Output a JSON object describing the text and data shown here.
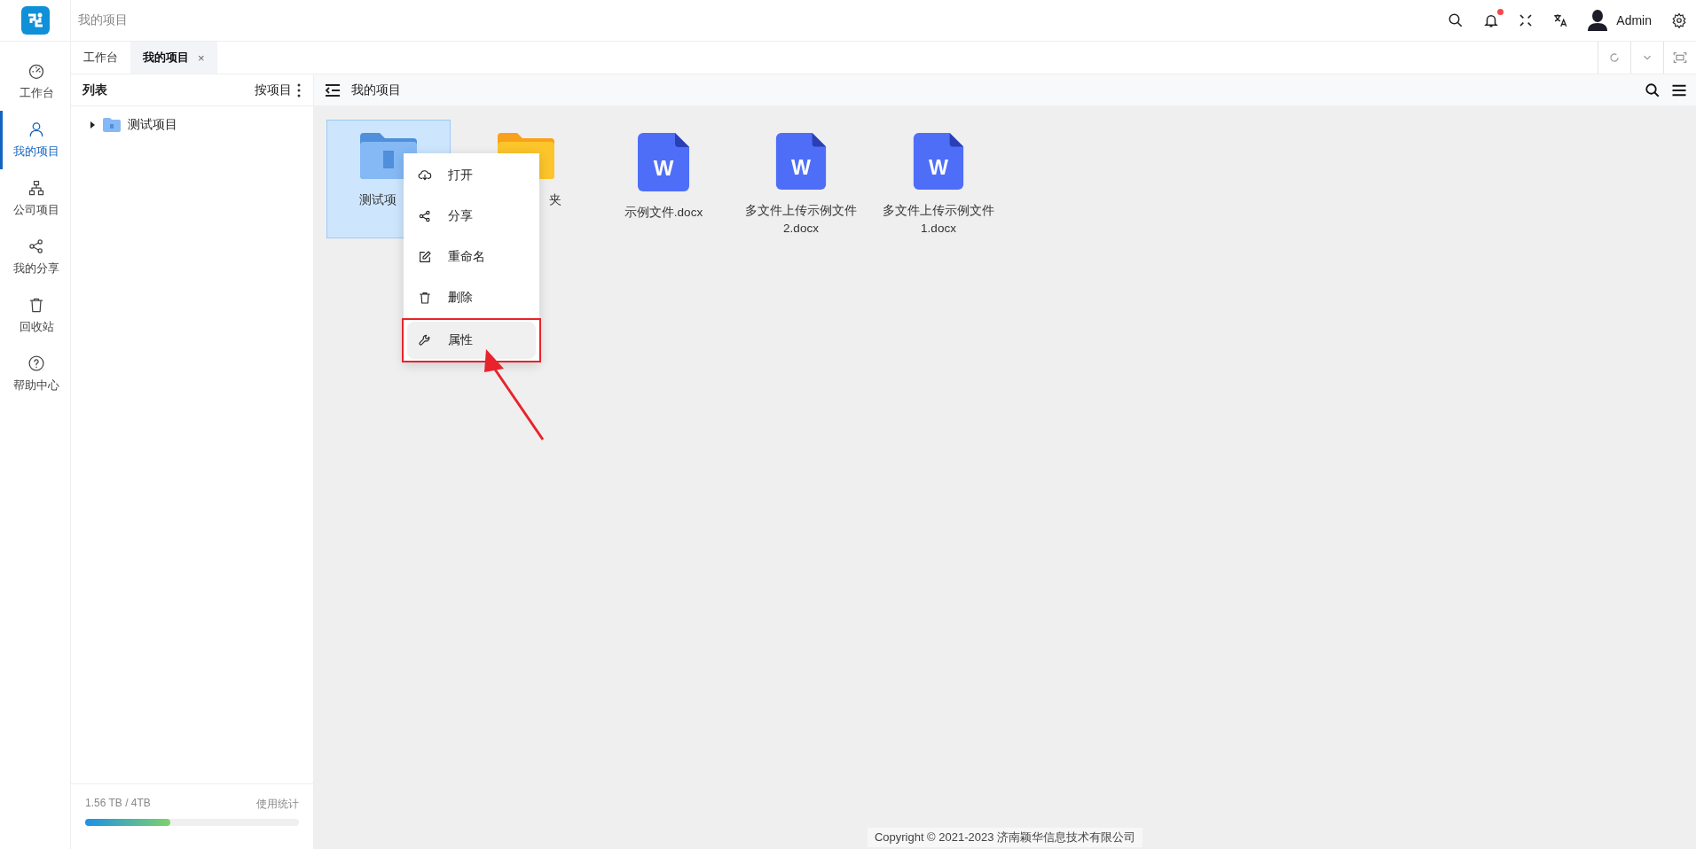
{
  "header": {
    "breadcrumb": "我的项目",
    "user": "Admin",
    "notification_dot": true
  },
  "nav": [
    {
      "label": "工作台",
      "selected": false
    },
    {
      "label": "我的项目",
      "selected": true
    },
    {
      "label": "公司项目",
      "selected": false
    },
    {
      "label": "我的分享",
      "selected": false
    },
    {
      "label": "回收站",
      "selected": false
    },
    {
      "label": "帮助中心",
      "selected": false
    }
  ],
  "tabs": [
    {
      "label": "工作台",
      "selected": false
    },
    {
      "label": "我的项目",
      "selected": true,
      "close": "×"
    }
  ],
  "panel": {
    "title": "列表",
    "sort": "按项目",
    "tree": [
      {
        "label": "测试项目",
        "expanded": false
      }
    ],
    "storage": {
      "usage": "1.56 TB / 4TB",
      "link": "使用统计",
      "level": 0.4
    }
  },
  "content": {
    "title": "我的项目",
    "files": [
      {
        "kind": "project",
        "name": "测试项",
        "selected": true
      },
      {
        "kind": "folder",
        "name": "夹",
        "selected": false
      },
      {
        "kind": "doc",
        "badge": "W",
        "name": "示例文件.docx",
        "selected": false
      },
      {
        "kind": "doc",
        "badge": "W",
        "name": "多文件上传示例文件2.docx",
        "selected": false
      },
      {
        "kind": "doc",
        "badge": "W",
        "name": "多文件上传示例文件1.docx",
        "selected": false
      }
    ]
  },
  "context_menu": {
    "items": [
      {
        "label": "打开",
        "highlighted": false,
        "annotated": false
      },
      {
        "label": "分享",
        "highlighted": false,
        "annotated": false
      },
      {
        "label": "重命名",
        "highlighted": false,
        "annotated": false
      },
      {
        "label": "删除",
        "highlighted": false,
        "annotated": false
      },
      {
        "label": "属性",
        "highlighted": true,
        "annotated": true
      }
    ]
  },
  "footer": {
    "copyright": "Copyright © 2021-2023 济南颖华信息技术有限公司"
  }
}
